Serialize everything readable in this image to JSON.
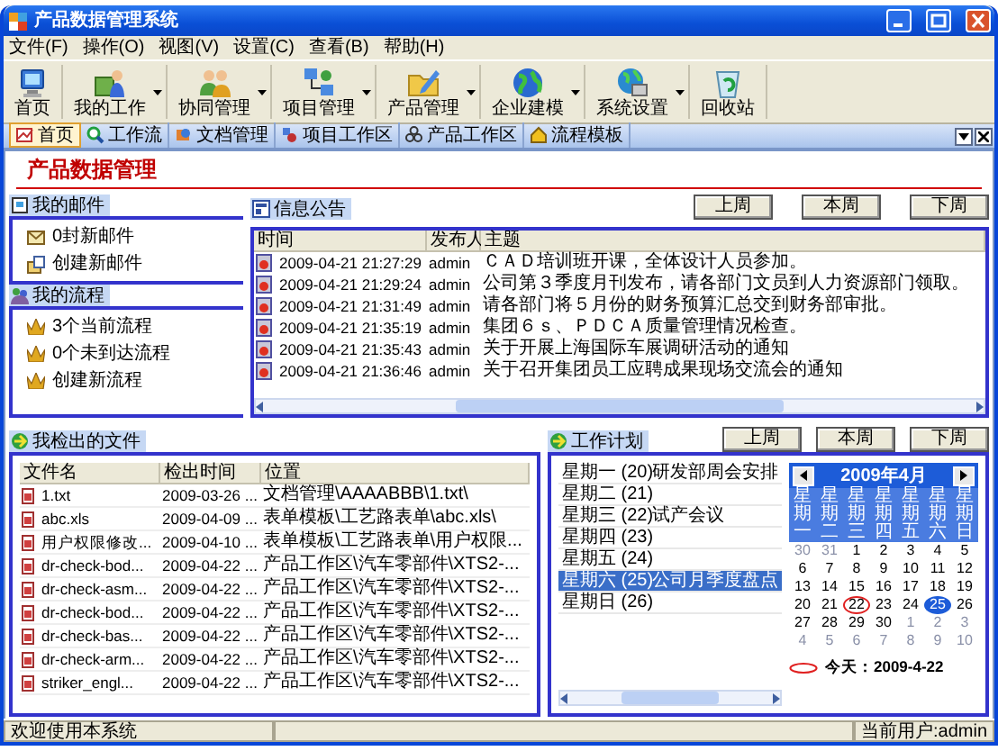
{
  "window": {
    "title": "产品数据管理系统"
  },
  "menu": [
    "文件(F)",
    "操作(O)",
    "视图(V)",
    "设置(C)",
    "查看(B)",
    "帮助(H)"
  ],
  "toolbar": [
    {
      "label": "首页",
      "dropdown": false
    },
    {
      "label": "我的工作",
      "dropdown": true
    },
    {
      "label": "协同管理",
      "dropdown": true
    },
    {
      "label": "项目管理",
      "dropdown": true
    },
    {
      "label": "产品管理",
      "dropdown": true
    },
    {
      "label": "企业建模",
      "dropdown": true
    },
    {
      "label": "系统设置",
      "dropdown": true
    },
    {
      "label": "回收站",
      "dropdown": false
    }
  ],
  "tabs": [
    {
      "label": "首页",
      "selected": true
    },
    {
      "label": "工作流",
      "selected": false
    },
    {
      "label": "文档管理",
      "selected": false
    },
    {
      "label": "项目工作区",
      "selected": false
    },
    {
      "label": "产品工作区",
      "selected": false
    },
    {
      "label": "流程模板",
      "selected": false
    }
  ],
  "page_title": "产品数据管理",
  "mail": {
    "title": "我的邮件",
    "items": [
      "0封新邮件",
      "创建新邮件"
    ]
  },
  "flow": {
    "title": "我的流程",
    "items": [
      "3个当前流程",
      "0个未到达流程",
      "创建新流程"
    ]
  },
  "news": {
    "title": "信息公告",
    "week_buttons": [
      "上周",
      "本周",
      "下周"
    ],
    "columns": [
      "时间",
      "发布人",
      "主题"
    ],
    "rows": [
      {
        "time": "2009-04-21 21:27:29",
        "author": "admin",
        "subject": "ＣＡＤ培训班开课，全体设计人员参加。"
      },
      {
        "time": "2009-04-21 21:29:24",
        "author": "admin",
        "subject": "公司第３季度月刊发布，请各部门文员到人力资源部门领取。"
      },
      {
        "time": "2009-04-21 21:31:49",
        "author": "admin",
        "subject": "请各部门将５月份的财务预算汇总交到财务部审批。"
      },
      {
        "time": "2009-04-21 21:35:19",
        "author": "admin",
        "subject": "集团６ｓ、ＰＤＣＡ质量管理情况检查。"
      },
      {
        "time": "2009-04-21 21:35:43",
        "author": "admin",
        "subject": "关于开展上海国际车展调研活动的通知"
      },
      {
        "time": "2009-04-21 21:36:46",
        "author": "admin",
        "subject": "关于召开集团员工应聘成果现场交流会的通知"
      }
    ]
  },
  "files": {
    "title": "我检出的文件",
    "columns": [
      "文件名",
      "检出时间",
      "位置"
    ],
    "rows": [
      {
        "name": "1.txt",
        "time": "2009-03-26 ...",
        "location": "文档管理\\AAAABBB\\1.txt\\"
      },
      {
        "name": "abc.xls",
        "time": "2009-04-09 ...",
        "location": "表单模板\\工艺路表单\\abc.xls\\"
      },
      {
        "name": "用户权限修改...",
        "time": "2009-04-10 ...",
        "location": "表单模板\\工艺路表单\\用户权限..."
      },
      {
        "name": "dr-check-bod...",
        "time": "2009-04-22 ...",
        "location": "产品工作区\\汽车零部件\\XTS2-..."
      },
      {
        "name": "dr-check-asm...",
        "time": "2009-04-22 ...",
        "location": "产品工作区\\汽车零部件\\XTS2-..."
      },
      {
        "name": "dr-check-bod...",
        "time": "2009-04-22 ...",
        "location": "产品工作区\\汽车零部件\\XTS2-..."
      },
      {
        "name": "dr-check-bas...",
        "time": "2009-04-22 ...",
        "location": "产品工作区\\汽车零部件\\XTS2-..."
      },
      {
        "name": "dr-check-arm...",
        "time": "2009-04-22 ...",
        "location": "产品工作区\\汽车零部件\\XTS2-..."
      },
      {
        "name": "striker_engl...",
        "time": "2009-04-22 ...",
        "location": "产品工作区\\汽车零部件\\XTS2-..."
      }
    ]
  },
  "plan": {
    "title": "工作计划",
    "week_buttons": [
      "上周",
      "本周",
      "下周"
    ],
    "days": [
      {
        "day": "星期一 (20)",
        "task": "研发部周会安排",
        "selected": false
      },
      {
        "day": "星期二 (21)",
        "selected": false
      },
      {
        "day": "星期三 (22)",
        "task": "试产会议",
        "selected": false
      },
      {
        "day": "星期四 (23)",
        "selected": false
      },
      {
        "day": "星期五 (24)",
        "selected": false
      },
      {
        "day": "星期六 (25)",
        "task": "公司月季度盘点",
        "selected": true
      },
      {
        "day": "星期日 (26)",
        "selected": false
      }
    ]
  },
  "calendar": {
    "title": "2009年4月",
    "weekdays": [
      "星期一",
      "星期二",
      "星期三",
      "星期四",
      "星期五",
      "星期六",
      "星期日"
    ],
    "days": [
      {
        "label": "30",
        "in_month": false,
        "today": false,
        "selected": false
      },
      {
        "label": "31",
        "in_month": false,
        "today": false,
        "selected": false
      },
      {
        "label": "1",
        "in_month": true,
        "today": false,
        "selected": false
      },
      {
        "label": "2",
        "in_month": true,
        "today": false,
        "selected": false
      },
      {
        "label": "3",
        "in_month": true,
        "today": false,
        "selected": false
      },
      {
        "label": "4",
        "in_month": true,
        "today": false,
        "selected": false
      },
      {
        "label": "5",
        "in_month": true,
        "today": false,
        "selected": false
      },
      {
        "label": "6",
        "in_month": true,
        "today": false,
        "selected": false
      },
      {
        "label": "7",
        "in_month": true,
        "today": false,
        "selected": false
      },
      {
        "label": "8",
        "in_month": true,
        "today": false,
        "selected": false
      },
      {
        "label": "9",
        "in_month": true,
        "today": false,
        "selected": false
      },
      {
        "label": "10",
        "in_month": true,
        "today": false,
        "selected": false
      },
      {
        "label": "11",
        "in_month": true,
        "today": false,
        "selected": false
      },
      {
        "label": "12",
        "in_month": true,
        "today": false,
        "selected": false
      },
      {
        "label": "13",
        "in_month": true,
        "today": false,
        "selected": false
      },
      {
        "label": "14",
        "in_month": true,
        "today": false,
        "selected": false
      },
      {
        "label": "15",
        "in_month": true,
        "today": false,
        "selected": false
      },
      {
        "label": "16",
        "in_month": true,
        "today": false,
        "selected": false
      },
      {
        "label": "17",
        "in_month": true,
        "today": false,
        "selected": false
      },
      {
        "label": "18",
        "in_month": true,
        "today": false,
        "selected": false
      },
      {
        "label": "19",
        "in_month": true,
        "today": false,
        "selected": false
      },
      {
        "label": "20",
        "in_month": true,
        "today": false,
        "selected": false
      },
      {
        "label": "21",
        "in_month": true,
        "today": false,
        "selected": false
      },
      {
        "label": "22",
        "in_month": true,
        "today": true,
        "selected": false
      },
      {
        "label": "23",
        "in_month": true,
        "today": false,
        "selected": false
      },
      {
        "label": "24",
        "in_month": true,
        "today": false,
        "selected": false
      },
      {
        "label": "25",
        "in_month": true,
        "today": false,
        "selected": true
      },
      {
        "label": "26",
        "in_month": true,
        "today": false,
        "selected": false
      },
      {
        "label": "27",
        "in_month": true,
        "today": false,
        "selected": false
      },
      {
        "label": "28",
        "in_month": true,
        "today": false,
        "selected": false
      },
      {
        "label": "29",
        "in_month": true,
        "today": false,
        "selected": false
      },
      {
        "label": "30",
        "in_month": true,
        "today": false,
        "selected": false
      },
      {
        "label": "1",
        "in_month": false,
        "today": false,
        "selected": false
      },
      {
        "label": "2",
        "in_month": false,
        "today": false,
        "selected": false
      },
      {
        "label": "3",
        "in_month": false,
        "today": false,
        "selected": false
      },
      {
        "label": "4",
        "in_month": false,
        "today": false,
        "selected": false
      },
      {
        "label": "5",
        "in_month": false,
        "today": false,
        "selected": false
      },
      {
        "label": "6",
        "in_month": false,
        "today": false,
        "selected": false
      },
      {
        "label": "7",
        "in_month": false,
        "today": false,
        "selected": false
      },
      {
        "label": "8",
        "in_month": false,
        "today": false,
        "selected": false
      },
      {
        "label": "9",
        "in_month": false,
        "today": false,
        "selected": false
      },
      {
        "label": "10",
        "in_month": false,
        "today": false,
        "selected": false
      }
    ],
    "today_label": "今天：2009-4-22"
  },
  "status_bar": [
    "欢迎使用本系统",
    "当前用户:admin"
  ]
}
